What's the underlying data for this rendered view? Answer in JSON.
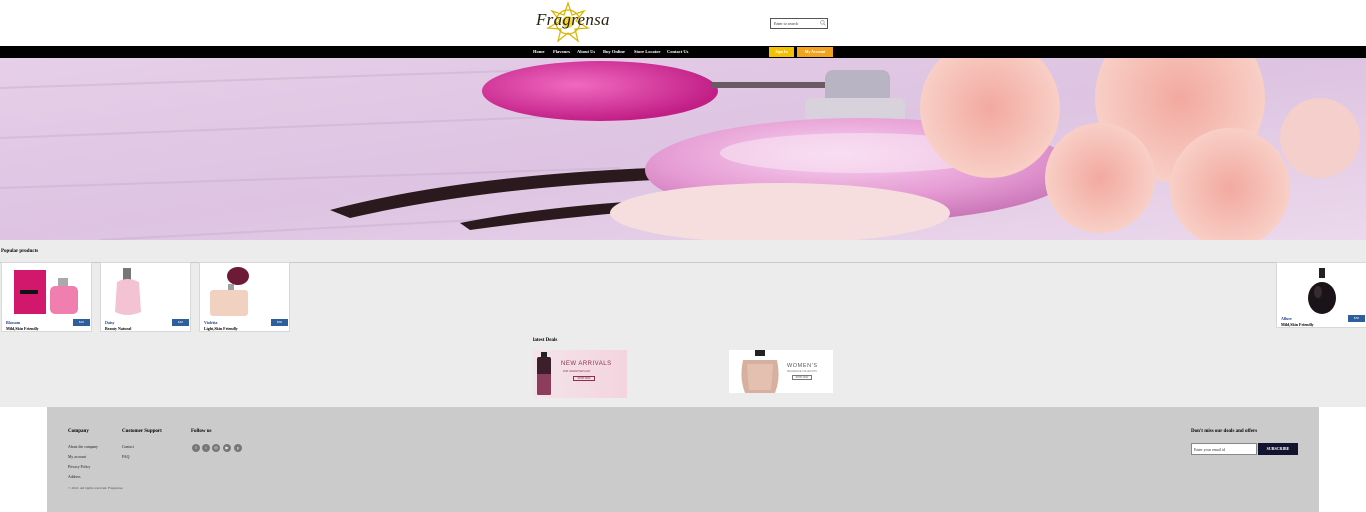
{
  "header": {
    "logo_text": "Fragrensa",
    "search_placeholder": "Enter to search"
  },
  "nav": {
    "items": [
      "Home",
      "Flavours",
      "About Us",
      "Buy Online",
      "Store Locator",
      "Contact Us"
    ],
    "signin_label": "Sign In",
    "account_label": "My Account"
  },
  "popular": {
    "title": "Popular products",
    "products": [
      {
        "name": "Blossom",
        "desc": "Mild,Skin Friendly",
        "price": "$20"
      },
      {
        "name": "Daisy",
        "desc": "Beauty Natural",
        "price": "$40"
      },
      {
        "name": "Violetta",
        "desc": "Light,Skin Friendly",
        "price": "$30"
      },
      {
        "name": "Allure",
        "desc": "Mild,Skin Friendly",
        "price": "$30"
      }
    ]
  },
  "deals": {
    "title": "latest Deals",
    "items": [
      {
        "headline": "NEW ARRIVALS",
        "sub": "FOR VALENTINE'S DAY",
        "btn": "SHOP NOW"
      },
      {
        "headline": "WOMEN'S",
        "sub": "FRAGRANCE COLLECTION",
        "btn": "SHOP NOW"
      }
    ]
  },
  "footer": {
    "company_title": "Company",
    "company_links": [
      "About the company",
      "My account",
      "Privacy Policy",
      "Address"
    ],
    "support_title": "Customer Support",
    "support_links": [
      "Contact",
      "FAQ"
    ],
    "follow_title": "Follow us",
    "social_icons": [
      "facebook-icon",
      "twitter-icon",
      "instagram-icon",
      "youtube-icon",
      "pinterest-icon"
    ],
    "copyright": "© 2021. All rights reserved. Fragrensa",
    "newsletter_title": "Don't miss our deals and offers",
    "email_placeholder": "Enter your email id",
    "subscribe_label": "SUBSCRIBE"
  },
  "colors": {
    "nav_bg": "#000000",
    "signin_btn": "#f5c000",
    "account_btn": "#f3a21f",
    "price_btn": "#2d5f9c",
    "subscribe_btn": "#12132e",
    "footer_bg": "#cbcbcb"
  }
}
